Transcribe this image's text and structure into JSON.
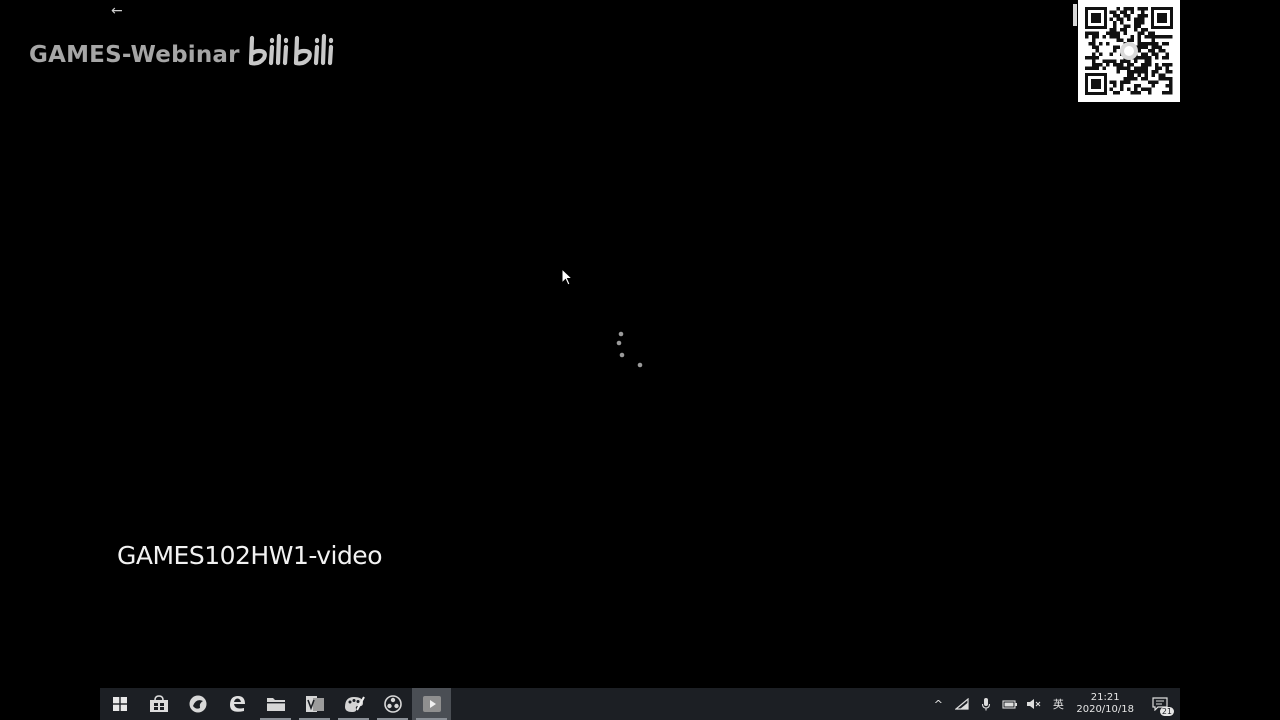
{
  "overlay": {
    "back_arrow": "←",
    "watermark_text": "GAMES-Webinar",
    "logo_text": "bilibili",
    "qr_icon": "qr-code"
  },
  "video": {
    "title": "GAMES102HW1-video",
    "state": "loading"
  },
  "taskbar": {
    "apps": [
      {
        "name": "start",
        "icon": "windows-logo-icon"
      },
      {
        "name": "store",
        "icon": "store-bag-icon"
      },
      {
        "name": "browser",
        "icon": "globe-icon"
      },
      {
        "name": "edge",
        "icon": "edge-icon"
      },
      {
        "name": "file-explorer",
        "icon": "folder-icon"
      },
      {
        "name": "app-pdf",
        "icon": "document-app-icon"
      },
      {
        "name": "paint",
        "icon": "palette-icon"
      },
      {
        "name": "obs",
        "icon": "record-icon"
      },
      {
        "name": "video-player",
        "icon": "play-icon"
      }
    ],
    "tray": {
      "chevron": "^",
      "ime": "英",
      "time": "21:21",
      "date": "2020/10/18",
      "notification_count": "21"
    }
  },
  "colors": {
    "background": "#000000",
    "taskbar": "#1c1f24",
    "title_text": "#f2f2f2",
    "watermark": "#a6a6a6"
  }
}
